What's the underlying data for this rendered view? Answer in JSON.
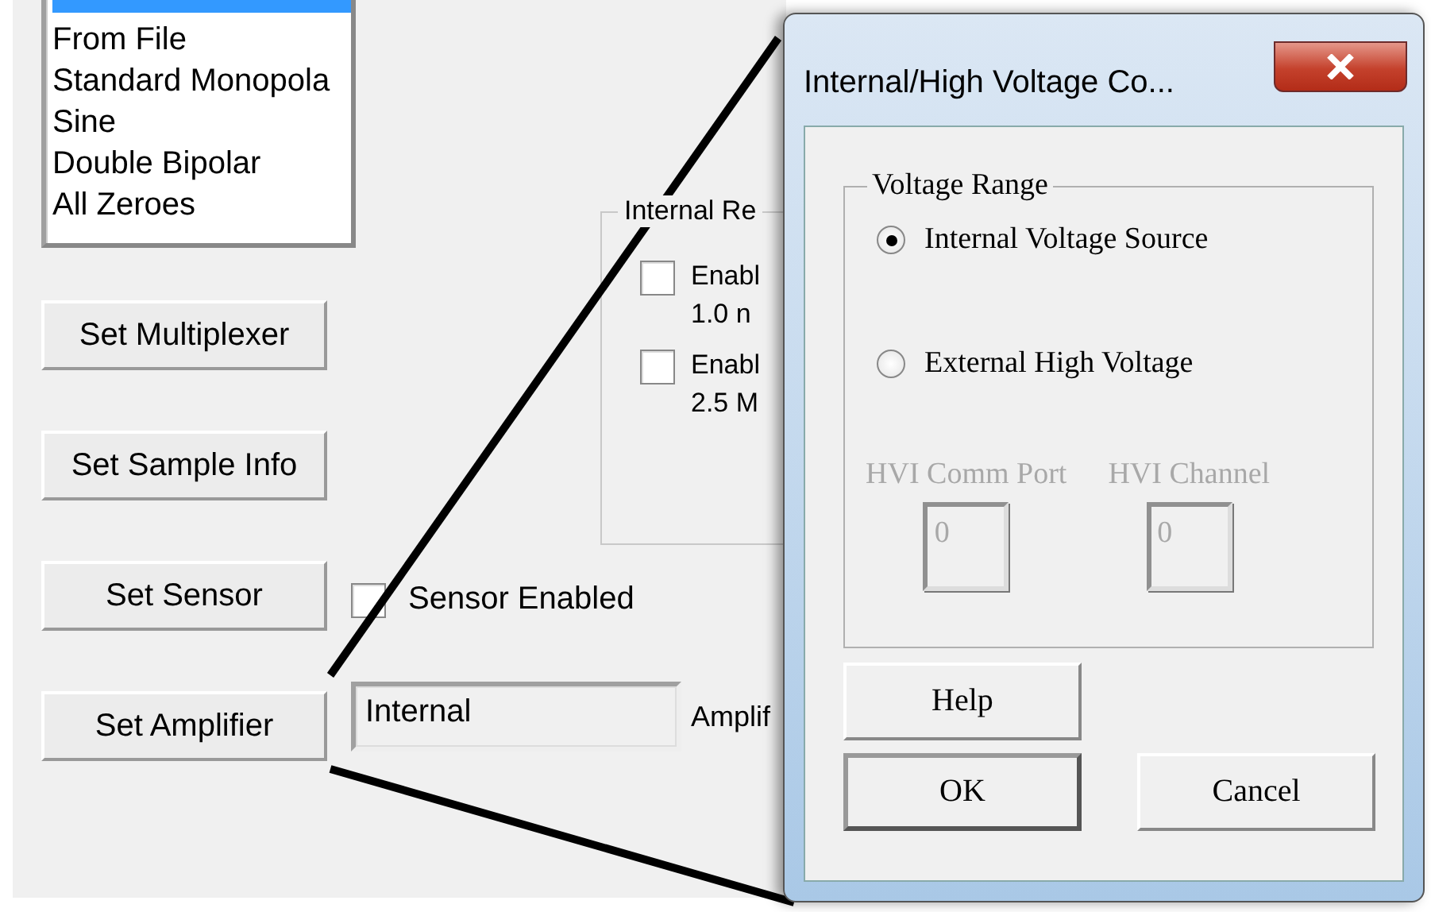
{
  "background_window": {
    "list_box": {
      "items": [
        {
          "label": "From File",
          "selected": false
        },
        {
          "label": "Standard Monopola",
          "selected": false
        },
        {
          "label": "Sine",
          "selected": false
        },
        {
          "label": "Double Bipolar",
          "selected": false
        },
        {
          "label": "All Zeroes",
          "selected": false
        }
      ]
    },
    "buttons": [
      "Set Multiplexer",
      "Set Sample Info",
      "Set Sensor",
      "Set Amplifier"
    ],
    "internal_group": {
      "title": "Internal Re",
      "checkboxes": [
        {
          "lines": [
            "Enabl",
            "1.0 n"
          ],
          "checked": false
        },
        {
          "lines": [
            "Enabl",
            "2.5 M"
          ],
          "checked": false
        }
      ]
    },
    "sensor_checkbox": {
      "label": "Sensor Enabled",
      "checked": false
    },
    "amplifier_field": {
      "value": "Internal"
    },
    "amplifier_label": "Amplif"
  },
  "dialog": {
    "title": "Internal/High Voltage Co...",
    "voltage_group": {
      "title": "Voltage Range",
      "radios": [
        {
          "label": "Internal Voltage Source",
          "selected": true
        },
        {
          "label": "External High Voltage",
          "selected": false
        }
      ]
    },
    "hvi_fields": [
      {
        "label": "HVI Comm Port",
        "value": "0",
        "disabled": true
      },
      {
        "label": "HVI Channel",
        "value": "0",
        "disabled": true
      }
    ],
    "buttons": [
      {
        "label": "Help",
        "default": false
      },
      {
        "label": "OK",
        "default": true
      },
      {
        "label": "Cancel",
        "default": false
      }
    ]
  }
}
